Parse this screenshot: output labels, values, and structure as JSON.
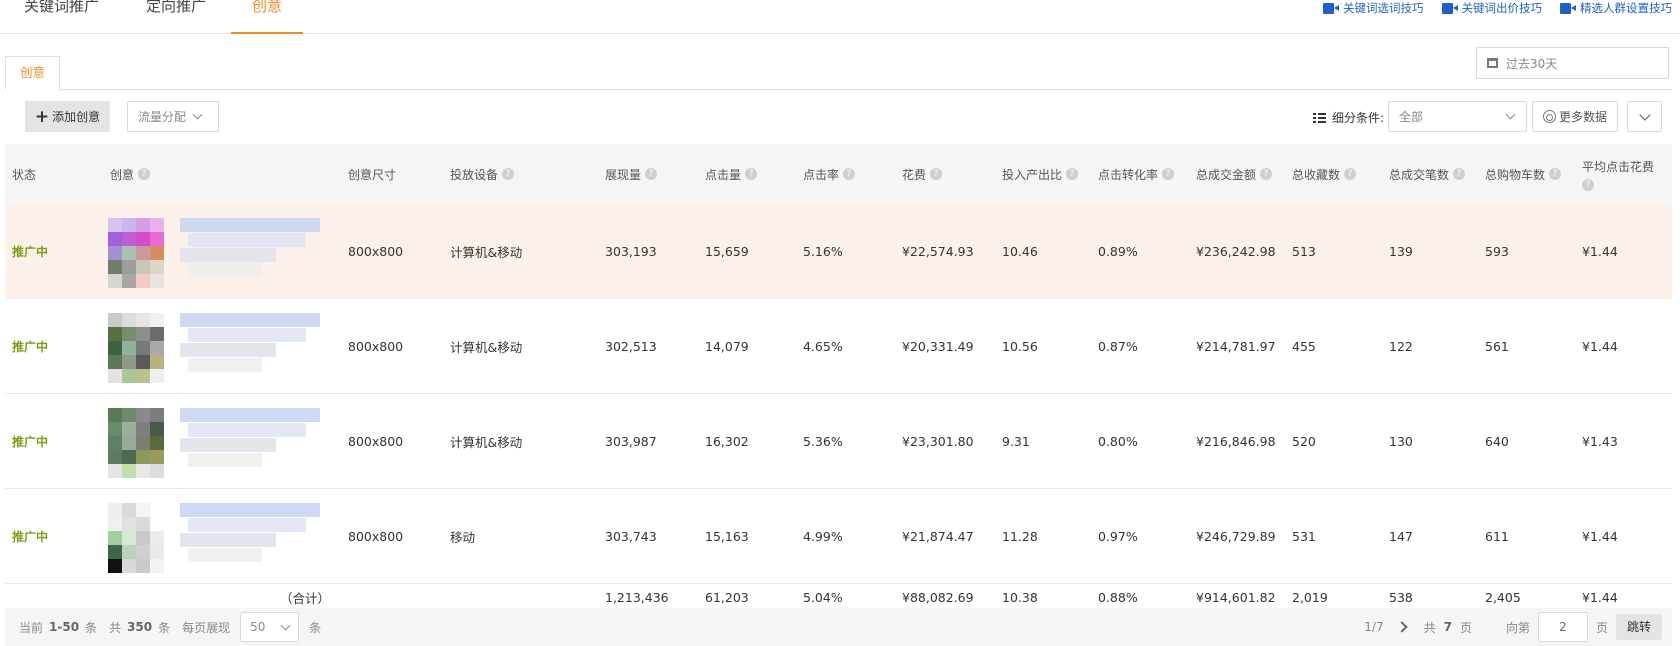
{
  "top_tabs": [
    "关键词推广",
    "定向推广",
    "创意"
  ],
  "help_links": [
    "关键词选词技巧",
    "关键词出价技巧",
    "精选人群设置技巧"
  ],
  "sub_tab": "创意",
  "date_range": "过去30天",
  "toolbar": {
    "add_creative": "添加创意",
    "traffic": "流量分配",
    "filter_label": "细分条件:",
    "filter_value": "全部",
    "more_data": "更多数据"
  },
  "columns": {
    "status": "状态",
    "creative": "创意",
    "size": "创意尺寸",
    "device": "投放设备",
    "impressions": "展现量",
    "clicks": "点击量",
    "ctr": "点击率",
    "cost": "花费",
    "roi": "投入产出比",
    "cvr": "点击转化率",
    "gmv": "总成交金额",
    "favorites": "总收藏数",
    "orders": "总成交笔数",
    "carts": "总购物车数",
    "cpc": "平均点击花费"
  },
  "rows": [
    {
      "status": "推广中",
      "size": "800x800",
      "device": "计算机&移动",
      "impressions": "303,193",
      "clicks": "15,659",
      "ctr": "5.16%",
      "cost": "¥22,574.93",
      "roi": "10.46",
      "cvr": "0.89%",
      "gmv": "¥236,242.98",
      "favorites": "513",
      "orders": "139",
      "carts": "593",
      "cpc": "¥1.44"
    },
    {
      "status": "推广中",
      "size": "800x800",
      "device": "计算机&移动",
      "impressions": "302,513",
      "clicks": "14,079",
      "ctr": "4.65%",
      "cost": "¥20,331.49",
      "roi": "10.56",
      "cvr": "0.87%",
      "gmv": "¥214,781.97",
      "favorites": "455",
      "orders": "122",
      "carts": "561",
      "cpc": "¥1.44"
    },
    {
      "status": "推广中",
      "size": "800x800",
      "device": "计算机&移动",
      "impressions": "303,987",
      "clicks": "16,302",
      "ctr": "5.36%",
      "cost": "¥23,301.80",
      "roi": "9.31",
      "cvr": "0.80%",
      "gmv": "¥216,846.98",
      "favorites": "520",
      "orders": "130",
      "carts": "640",
      "cpc": "¥1.43"
    },
    {
      "status": "推广中",
      "size": "800x800",
      "device": "移动",
      "impressions": "303,743",
      "clicks": "15,163",
      "ctr": "4.99%",
      "cost": "¥21,874.47",
      "roi": "11.28",
      "cvr": "0.97%",
      "gmv": "¥246,729.89",
      "favorites": "531",
      "orders": "147",
      "carts": "611",
      "cpc": "¥1.44"
    }
  ],
  "total": {
    "label": "（合计）",
    "impressions": "1,213,436",
    "clicks": "61,203",
    "ctr": "5.04%",
    "cost": "¥88,082.69",
    "roi": "10.38",
    "cvr": "0.88%",
    "gmv": "¥914,601.82",
    "favorites": "2,019",
    "orders": "538",
    "carts": "2,405",
    "cpc": "¥1.44"
  },
  "pagination": {
    "current_prefix": "当前",
    "current_range": "1-50",
    "current_suffix": "条",
    "total_prefix": "共",
    "total_count": "350",
    "total_suffix": "条",
    "per_page_label": "每页展现",
    "per_page": "50",
    "per_page_suffix": "条",
    "page_indicator": "1/7",
    "total_pages_prefix": "共",
    "total_pages": "7",
    "total_pages_suffix": "页",
    "goto_prefix": "向第",
    "goto_value": "2",
    "goto_suffix": "页",
    "jump": "跳转"
  }
}
